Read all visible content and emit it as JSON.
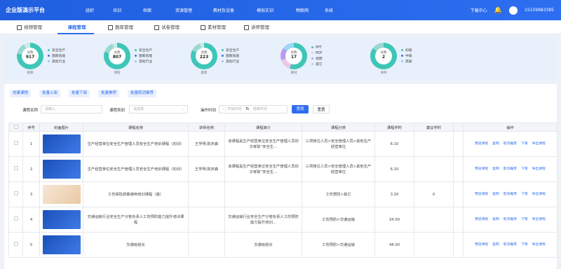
{
  "app": {
    "title": "企业版演示平台"
  },
  "nav": {
    "items": [
      "组织",
      "培训",
      "档案",
      "资源管理",
      "教材及设备",
      "模拟实训",
      "物联网",
      "系统"
    ]
  },
  "header_right": {
    "download": "下载中心",
    "phone": "15159983385"
  },
  "tabs": [
    "视频管理",
    "课程管理",
    "题库管理",
    "试卷管理",
    "素材管理",
    "讲师管理"
  ],
  "active_tab": "课程管理",
  "stats": [
    {
      "center_label": "总数",
      "value": "917",
      "caption": "视频",
      "legend": [
        "安全生产",
        "国家技能",
        "其他行业"
      ]
    },
    {
      "center_label": "总数",
      "value": "807",
      "caption": "课程",
      "legend": [
        "安全生产",
        "国家技能",
        "其他行业"
      ]
    },
    {
      "center_label": "总数",
      "value": "223",
      "caption": "题库",
      "legend": [
        "安全生产",
        "国家技能",
        "其他行业"
      ]
    },
    {
      "center_label": "总数",
      "value": "17",
      "caption": "素材",
      "legend": [
        "PPT",
        "PDF",
        "视频",
        "其它"
      ]
    },
    {
      "center_label": "总数",
      "value": "2",
      "caption": "讲师",
      "legend": [
        "初级",
        "中级",
        "高级"
      ]
    }
  ],
  "actions": [
    "创建课程",
    "批量上架",
    "批量下架",
    "批量推荐",
    "批量取消推荐"
  ],
  "filters": {
    "course_name_label": "课程名称",
    "course_name_placeholder": "请输入",
    "course_type_label": "课程类别",
    "course_type_placeholder": "请选择",
    "time_label": "操作时间",
    "start_placeholder": "开始时间",
    "to": "To",
    "end_placeholder": "结束时间",
    "search": "查找",
    "reset": "重置"
  },
  "table": {
    "headers": [
      "序号",
      "封面图片",
      "课程名称",
      "讲师名称",
      "课程简介",
      "课程分类",
      "课程学时",
      "建议学时",
      "",
      "操作"
    ],
    "rows": [
      {
        "no": "1",
        "name": "生产经营单位安全生产管理人员安全生产培训课程（初训）",
        "teacher": "王学明,陈庆森",
        "intro": "该课程是生产经营单位安全生产管理人员初次考取“安全生…",
        "category": "三项岗位人员>安全管理人员>其他生产经营单位",
        "hours": "6.10",
        "suggest": "",
        "cover": "blue"
      },
      {
        "no": "2",
        "name": "生产经营单位安全生产管理人员安全生产培训课程（初训）",
        "teacher": "王学明,陈庆森",
        "intro": "该课程是生产经营单位安全生产管理人员初次考取“安全生…",
        "category": "三项岗位人员>安全管理人员>其他生产经营单位",
        "hours": "6.10",
        "suggest": "",
        "cover": "blue"
      },
      {
        "no": "3",
        "name": "工伤保险政策通用培训课程（版）",
        "teacher": "",
        "intro": "",
        "category": "工伤预防>其它",
        "hours": "3.20",
        "suggest": "0",
        "cover": "alt"
      },
      {
        "no": "4",
        "name": "交通运输行业安全生产分管负责人工伤预防能力提升培训课程",
        "teacher": "",
        "intro": "交通运输行业安全生产分管负责人工伤预防能力提升培训…",
        "category": "工伤预防>交通运输",
        "hours": "34.00",
        "suggest": "",
        "cover": "blue"
      },
      {
        "no": "5",
        "name": "交通班组长",
        "teacher": "",
        "intro": "交通班组长",
        "category": "工伤预防>交通运输",
        "hours": "48.00",
        "suggest": "",
        "cover": "blue"
      }
    ],
    "row_ops": [
      "预览课程",
      "复制",
      "取消推荐",
      "下架",
      "导出课程"
    ]
  },
  "colors": {
    "primary": "#2d6ef0",
    "donut": "#3ec6b8",
    "donut_alt": "#e8c8e8"
  }
}
